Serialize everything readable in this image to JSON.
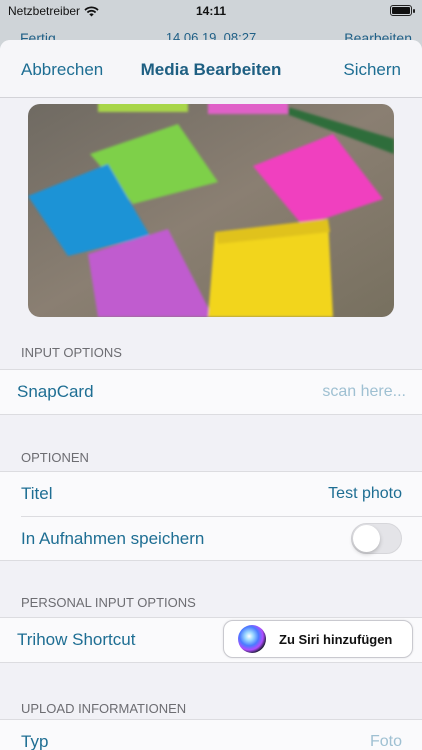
{
  "status_bar": {
    "carrier": "Netzbetreiber",
    "time": "14:11",
    "battery_level": 1.0
  },
  "behind": {
    "left": "Fertig",
    "center": "14.06.19, 08:27",
    "right": "Bearbeiten"
  },
  "navbar": {
    "cancel_label": "Abbrechen",
    "title": "Media Bearbeiten",
    "save_label": "Sichern"
  },
  "sections": {
    "input_options": {
      "header": "INPUT OPTIONS",
      "snapcard_label": "SnapCard",
      "snapcard_placeholder": "scan here..."
    },
    "optionen": {
      "header": "OPTIONEN",
      "title_label": "Titel",
      "title_value": "Test photo",
      "save_label": "In Aufnahmen speichern",
      "save_enabled": false
    },
    "personal_input_options": {
      "header": "PERSONAL INPUT OPTIONS",
      "shortcut_label": "Trihow Shortcut",
      "siri_button_label": "Zu Siri hinzufügen"
    },
    "upload": {
      "header": "UPLOAD INFORMATIONEN",
      "type_label": "Typ",
      "type_value": "Foto"
    }
  },
  "colors": {
    "accent": "#1e6e93",
    "title": "#1e5f82",
    "background": "#f1f1f6",
    "section_header": "#6d6d72"
  }
}
